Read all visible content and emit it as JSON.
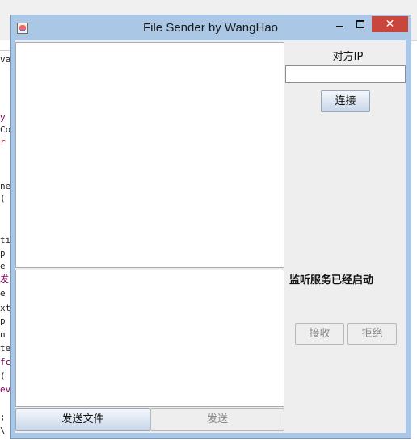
{
  "window": {
    "title": "File Sender by WangHao",
    "close_symbol": "✕"
  },
  "background_code": [
    "va",
    "y",
    "Co",
    "r",
    "ne",
    "(",
    "ti",
    "p",
    "e",
    "发",
    "e",
    "xt",
    "p",
    "n",
    "te",
    "fc",
    "(",
    "ev",
    ";",
    "\\"
  ],
  "panel": {
    "ip_label": "对方IP",
    "ip_value": "",
    "connect_label": "连接",
    "status": "监听服务已经启动",
    "accept_label": "接收",
    "reject_label": "拒绝"
  },
  "footer": {
    "send_file_label": "发送文件",
    "send_label": "发送"
  },
  "colors": {
    "title_bar": "#aac7e5",
    "close_button": "#c9463d",
    "content_bg": "#eeeeee"
  },
  "icons": {
    "app": "java-cup-icon",
    "minimize": "minimize-icon",
    "maximize": "maximize-icon",
    "close": "close-icon"
  }
}
